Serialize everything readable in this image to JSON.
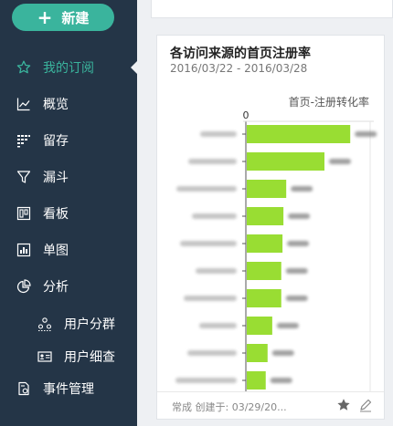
{
  "sidebar": {
    "new_button": {
      "plus": "+",
      "label": "新建"
    },
    "items": [
      {
        "label": "我的订阅",
        "icon": "star-icon",
        "active": true
      },
      {
        "label": "概览",
        "icon": "line-chart-icon"
      },
      {
        "label": "留存",
        "icon": "retention-icon"
      },
      {
        "label": "漏斗",
        "icon": "funnel-icon"
      },
      {
        "label": "看板",
        "icon": "board-icon"
      },
      {
        "label": "单图",
        "icon": "bar-chart-icon"
      },
      {
        "label": "分析",
        "icon": "pie-chart-icon"
      },
      {
        "label": "用户分群",
        "icon": "user-group-icon"
      },
      {
        "label": "用户细查",
        "icon": "user-card-icon"
      },
      {
        "label": "事件管理",
        "icon": "event-manage-icon"
      }
    ],
    "active_color": "#3ab49d"
  },
  "card": {
    "title": "各访问来源的首页注册率",
    "date_range": "2016/03/22 - 2016/03/28",
    "footer": "常成 创建于: 03/29/20...",
    "footer_icons": [
      "star-icon",
      "edit-icon"
    ]
  },
  "chart_data": {
    "type": "bar",
    "orientation": "horizontal",
    "xlabel": "首页-注册转化率",
    "x_tick_start": "0",
    "bar_color": "#99dd33",
    "values": [
      0.333,
      0.25,
      0.127,
      0.118,
      0.115,
      0.111,
      0.111,
      0.082,
      0.067,
      0.061
    ],
    "xlim": [
      0,
      0.4
    ],
    "categories_blurred": true,
    "value_labels_blurred": true
  }
}
